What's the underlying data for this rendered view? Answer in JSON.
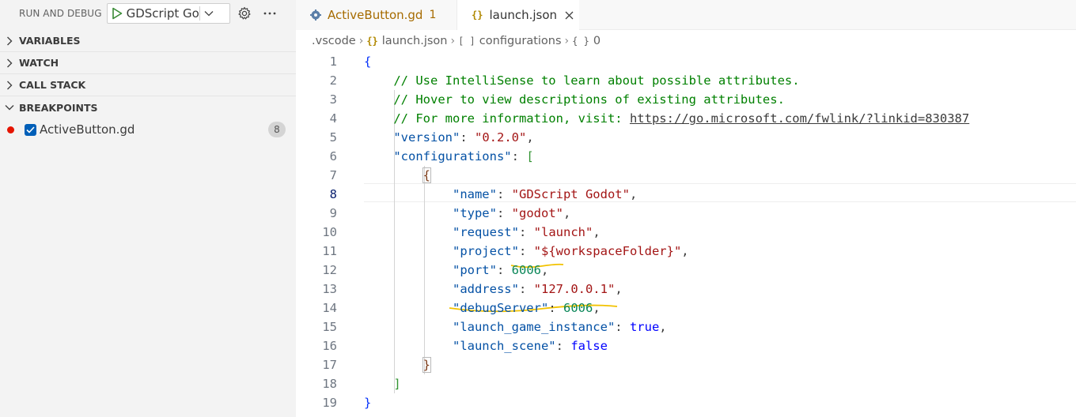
{
  "sidebar": {
    "title": "RUN AND DEBUG",
    "config_selected": "GDScript Godot",
    "sections": [
      {
        "label": "VARIABLES",
        "expanded": false
      },
      {
        "label": "WATCH",
        "expanded": false
      },
      {
        "label": "CALL STACK",
        "expanded": false
      },
      {
        "label": "BREAKPOINTS",
        "expanded": true
      }
    ],
    "breakpoints": [
      {
        "file": "ActiveButton.gd",
        "count": "8",
        "checked": true
      }
    ]
  },
  "tabs": [
    {
      "label": "ActiveButton.gd",
      "badge": "1",
      "icon": "gear-file-icon",
      "active": false
    },
    {
      "label": "launch.json",
      "icon": "json-braces-icon",
      "active": true
    }
  ],
  "breadcrumb": {
    "folder": ".vscode",
    "file": "launch.json",
    "array": "configurations",
    "object": "0",
    "array_icon": "[ ]",
    "object_icon": "{ }",
    "file_icon": "{}"
  },
  "editor": {
    "current_line": 8,
    "lines": [
      {
        "n": "1",
        "tokens": [
          {
            "t": "{",
            "c": "c-brace"
          }
        ]
      },
      {
        "n": "2",
        "tokens": [
          {
            "t": "    // Use IntelliSense to learn about possible attributes.",
            "c": "c-com"
          }
        ]
      },
      {
        "n": "3",
        "tokens": [
          {
            "t": "    // Hover to view descriptions of existing attributes.",
            "c": "c-com"
          }
        ]
      },
      {
        "n": "4",
        "tokens": [
          {
            "t": "    // For more information, visit: ",
            "c": "c-com"
          },
          {
            "t": "https://go.microsoft.com/fwlink/?linkid=830387",
            "c": "c-com c-url"
          }
        ]
      },
      {
        "n": "5",
        "tokens": [
          {
            "t": "    ",
            "c": ""
          },
          {
            "t": "\"version\"",
            "c": "c-key"
          },
          {
            "t": ": ",
            "c": ""
          },
          {
            "t": "\"0.2.0\"",
            "c": "c-str"
          },
          {
            "t": ",",
            "c": ""
          }
        ]
      },
      {
        "n": "6",
        "tokens": [
          {
            "t": "    ",
            "c": ""
          },
          {
            "t": "\"configurations\"",
            "c": "c-key"
          },
          {
            "t": ": ",
            "c": ""
          },
          {
            "t": "[",
            "c": "c-brk"
          }
        ]
      },
      {
        "n": "7",
        "tokens": [
          {
            "t": "        ",
            "c": ""
          },
          {
            "t": "{",
            "c": "c-brace2 bracket-box"
          }
        ]
      },
      {
        "n": "8",
        "tokens": [
          {
            "t": "            ",
            "c": ""
          },
          {
            "t": "\"name\"",
            "c": "c-key"
          },
          {
            "t": ": ",
            "c": ""
          },
          {
            "t": "\"GDScript Godot\"",
            "c": "c-str"
          },
          {
            "t": ",",
            "c": ""
          }
        ]
      },
      {
        "n": "9",
        "tokens": [
          {
            "t": "            ",
            "c": ""
          },
          {
            "t": "\"type\"",
            "c": "c-key"
          },
          {
            "t": ": ",
            "c": ""
          },
          {
            "t": "\"godot\"",
            "c": "c-str"
          },
          {
            "t": ",",
            "c": ""
          }
        ]
      },
      {
        "n": "10",
        "tokens": [
          {
            "t": "            ",
            "c": ""
          },
          {
            "t": "\"request\"",
            "c": "c-key"
          },
          {
            "t": ": ",
            "c": ""
          },
          {
            "t": "\"launch\"",
            "c": "c-str"
          },
          {
            "t": ",",
            "c": ""
          }
        ]
      },
      {
        "n": "11",
        "tokens": [
          {
            "t": "            ",
            "c": ""
          },
          {
            "t": "\"project\"",
            "c": "c-key"
          },
          {
            "t": ": ",
            "c": ""
          },
          {
            "t": "\"${workspaceFolder}\"",
            "c": "c-str"
          },
          {
            "t": ",",
            "c": ""
          }
        ]
      },
      {
        "n": "12",
        "tokens": [
          {
            "t": "            ",
            "c": ""
          },
          {
            "t": "\"port\"",
            "c": "c-key"
          },
          {
            "t": ": ",
            "c": ""
          },
          {
            "t": "6006",
            "c": "c-num"
          },
          {
            "t": ",",
            "c": ""
          }
        ]
      },
      {
        "n": "13",
        "tokens": [
          {
            "t": "            ",
            "c": ""
          },
          {
            "t": "\"address\"",
            "c": "c-key"
          },
          {
            "t": ": ",
            "c": ""
          },
          {
            "t": "\"127.0.0.1\"",
            "c": "c-str"
          },
          {
            "t": ",",
            "c": ""
          }
        ]
      },
      {
        "n": "14",
        "tokens": [
          {
            "t": "            ",
            "c": ""
          },
          {
            "t": "\"debugServer\"",
            "c": "c-key"
          },
          {
            "t": ": ",
            "c": ""
          },
          {
            "t": "6006",
            "c": "c-num"
          },
          {
            "t": ",",
            "c": ""
          }
        ]
      },
      {
        "n": "15",
        "tokens": [
          {
            "t": "            ",
            "c": ""
          },
          {
            "t": "\"launch_game_instance\"",
            "c": "c-key"
          },
          {
            "t": ": ",
            "c": ""
          },
          {
            "t": "true",
            "c": "c-bool"
          },
          {
            "t": ",",
            "c": ""
          }
        ]
      },
      {
        "n": "16",
        "tokens": [
          {
            "t": "            ",
            "c": ""
          },
          {
            "t": "\"launch_scene\"",
            "c": "c-key"
          },
          {
            "t": ": ",
            "c": ""
          },
          {
            "t": "false",
            "c": "c-bool"
          }
        ]
      },
      {
        "n": "17",
        "tokens": [
          {
            "t": "        ",
            "c": ""
          },
          {
            "t": "}",
            "c": "c-brace2 bracket-box"
          }
        ]
      },
      {
        "n": "18",
        "tokens": [
          {
            "t": "    ",
            "c": ""
          },
          {
            "t": "]",
            "c": "c-brk"
          }
        ]
      },
      {
        "n": "19",
        "tokens": [
          {
            "t": "}",
            "c": "c-brace"
          }
        ]
      }
    ]
  },
  "colors": {
    "breakpoint": "#e51400",
    "checkbox": "#005fb8",
    "annotation": "#f2c200"
  }
}
